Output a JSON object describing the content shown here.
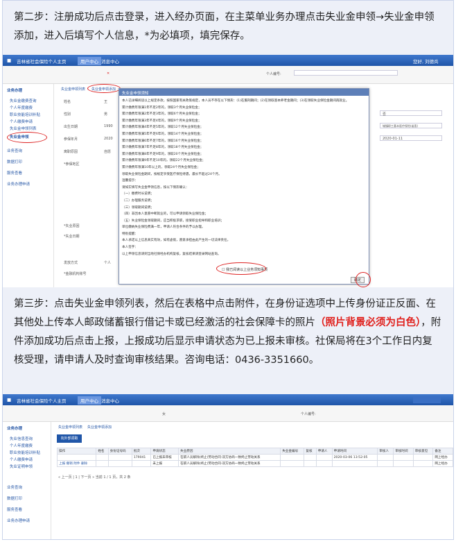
{
  "step2": {
    "text": "第二步：注册成功后点击登录，进入经办页面，在主菜单业务办理点击失业金申领→失业金申领添加，进入后填写个人信息，*为必填项，填完保存。"
  },
  "step3": {
    "text_before": "第三步：点击失业金申领列表，然后在表格中点击附件，在身份证选项中上传身份证正反面、在其他处上传本人邮政储蓄银行借记卡或已经激活的社会保障卡的照片",
    "highlight": "（照片背景必须为白色）",
    "text_after": "，附件添加成功后点击上报，上报成功后显示申请状态为已上报未审核。社保局将在3个工作日内复核受理，请申请人及时查询审核结果。咨询电话：0436-3351660。"
  },
  "shot1": {
    "app_title": "吉林省社会保险个人主页",
    "nav_tabs": [
      "用户中心",
      "消息中心"
    ],
    "user": "您好, 刘德兵",
    "side_header": "业务办理",
    "side_items": [
      "失业金缴费查询",
      "个人年度缴费",
      "职业技能培训补贴",
      "个人缴费申请",
      "失业金申领列表",
      "失业金申领"
    ],
    "side_groups": [
      "业务查询",
      "数据打印",
      "服务查看",
      "业务办理申请"
    ],
    "page_tabs": [
      "失业金申领列表",
      "失业金申领添加"
    ],
    "form_labels": [
      "姓名",
      "性别",
      "出生日期",
      "参保年月",
      "离职原因",
      "*参保地区",
      "*失业原因",
      "*失业日期",
      "发放方式",
      "*金融机构账号"
    ],
    "form_values": [
      "王",
      "男",
      "1990",
      "2020",
      "自愿",
      "否",
      "城镇职工基本医疗保险(省直)",
      "2020-01-11",
      "个人"
    ],
    "modal_title": "失业金申领须知",
    "modal_lines": [
      "本人已详细阅读以上规定条款，按照国家有关政策规定，本人员不存在以下情形：(1)在服刑期间；(2)在领取基本养老金期间；(3)在领取失业保险金期间再就业。",
      "累计缴费年限满1年不足2年的，领取3个月失业保险金；",
      "累计缴费年限满2年不足3年的，领取6个月失业保险金；",
      "累计缴费年限满3年不足4年的，领取9个月失业保险金；",
      "累计缴费年限满4年不足5年的，领取12个月失业保险金；",
      "累计缴费年限满5年不足6年的，领取14个月失业保险金；",
      "累计缴费年限满6年不足7年的，领取16个月失业保险金；",
      "累计缴费年限满7年不足8年的，领取18个月失业保险金；",
      "累计缴费年限满8年不足9年的，领取20个月失业保险金；",
      "累计缴费年限满9年不足10年的，领取22个月失业保险金；",
      "累计缴费年限满10年以上的，领取24个月失业保险金；",
      "领取失业保险金期间，按规定享受医疗保险待遇，最长不超过24个月。",
      "温馨提示：",
      "请如实填写失业金申领信息，按以下情形确认：",
      "（一）缴费时长说明；",
      "（二）办理服务说明；",
      "（三）领取期间说明；",
      "（四）非因本人意愿中断就业的，可以申请领取失业保险金；",
      "（五）失业保险金领取期间，应当积极求职，接受职业指导和职业培训；",
      "单位缴纳失业保险费满一年，申请人符合条件的予以办理。",
      "特别提醒：",
      "本人承诺以上信息真实有效，如有虚假，愿意承担由此产生的一切法律责任。",
      "本人签字：",
      "以上申领信息请到当地社保经办机构复核，复核结果请登录网站查询。"
    ],
    "modal_checkbox": "我已阅读以上业务须知事项",
    "modal_button": "确定"
  },
  "shot2": {
    "app_title": "吉林省社会保险个人主页",
    "nav_tabs": [
      "用户中心",
      "消息中心"
    ],
    "gender": "女",
    "id_label": "个人编号:",
    "side_header": "业务办理",
    "side_items": [
      "失业信息查询",
      "个人年度缴费",
      "职业技能培训补贴",
      "个人缴费申请",
      "失业证明申领"
    ],
    "side_groups": [
      "业务查询",
      "数据打印",
      "服务查看",
      "业务办理申请"
    ],
    "page_tabs": [
      "失业金申领列表",
      "失业金申领添加"
    ],
    "action_button": "向外部调取",
    "columns": [
      "操作",
      "姓名",
      "身份证号码",
      "批次",
      "申请状态",
      "失业原因",
      "失业金编号",
      "复核",
      "申请人",
      "申请时间",
      "审核人",
      "审核时间",
      "审核意见",
      "备注"
    ],
    "rows": [
      {
        "ops": "",
        "batch": "179041",
        "status": "已上报未审核",
        "reason": "在职人员解除(终止)劳动合同-双方协商一致终止劳动关系",
        "time": "2020-03-06 13:52:05",
        "note": "网上经办"
      },
      {
        "ops": "上报 撤销 附件 删除",
        "batch": "",
        "status": "未上报",
        "reason": "在职人员解除(终止)劳动合同-双方协商一致终止劳动关系",
        "time": "",
        "note": "网上经办"
      }
    ],
    "pager": "« 上一页 | 1 | 下一页 » 当前 1 / 1 页，共 2 条"
  },
  "colors": {
    "accent": "#1f55a8",
    "highlight": "#e0201c",
    "panel": "#edf0f8"
  }
}
